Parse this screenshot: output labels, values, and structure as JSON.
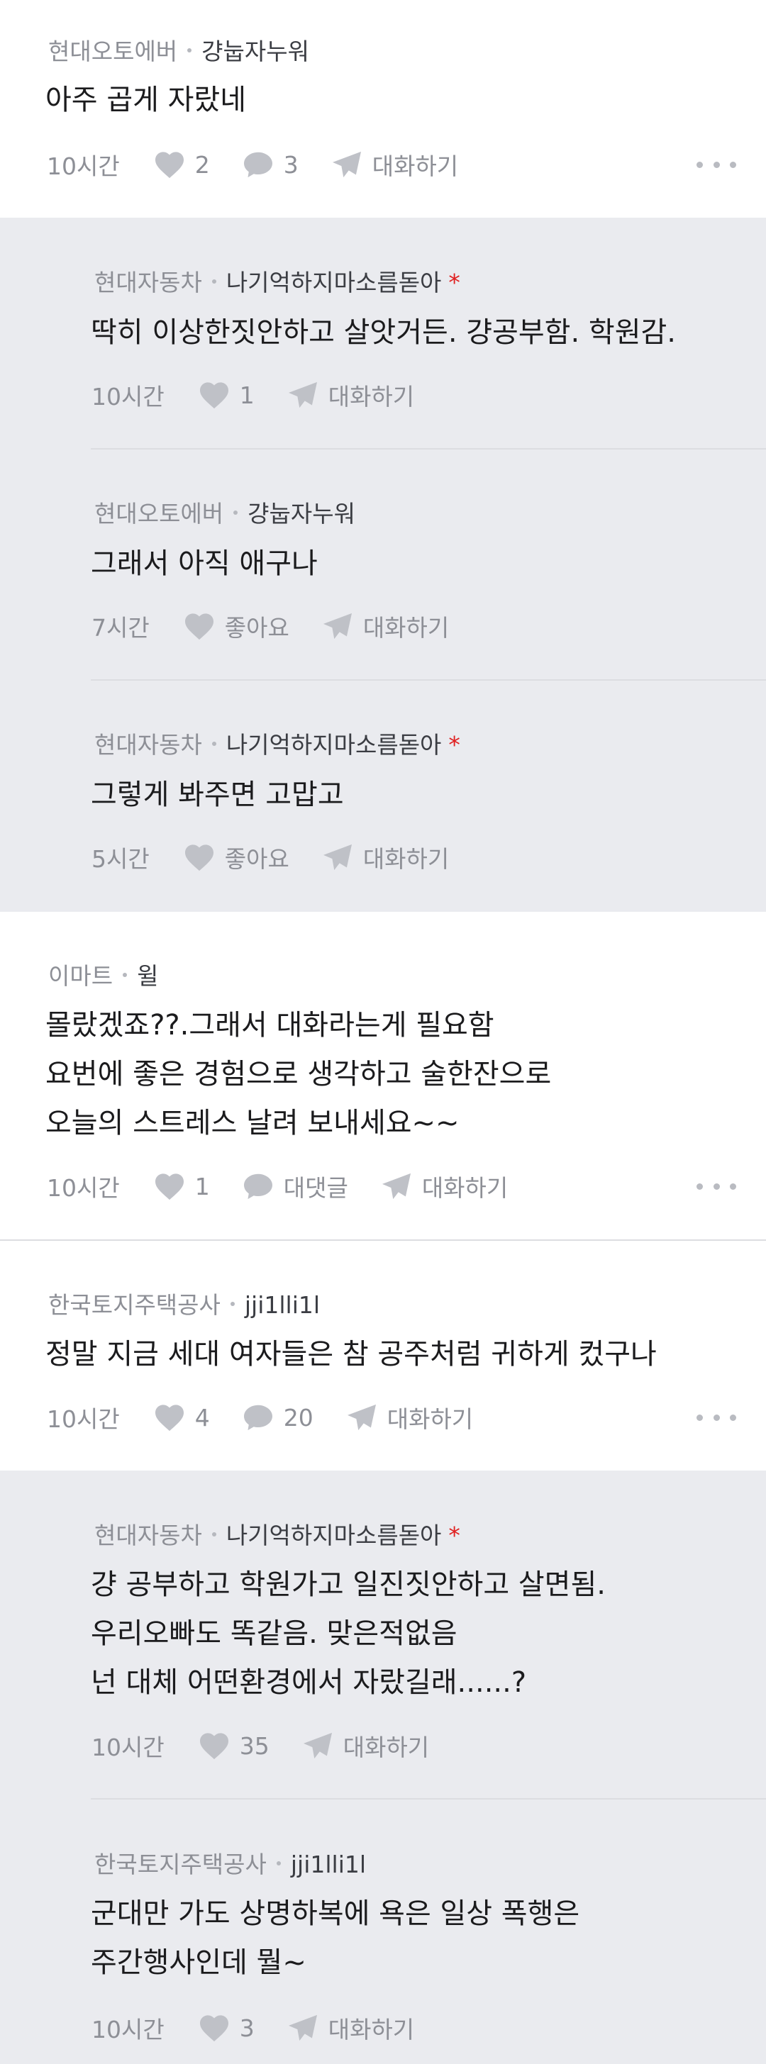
{
  "comments": [
    {
      "company": "현대오토에버",
      "nickname": "걍눕자누워",
      "op": "",
      "text": "아주 곱게 자랐네",
      "time": "10시간",
      "like": "2",
      "reply": "3",
      "talk": "대화하기"
    },
    {
      "company": "현대자동차",
      "nickname": "나기억하지마소름돋아",
      "op": "*",
      "text": "딱히 이상한짓안하고 살앗거든. 걍공부함. 학원감.",
      "time": "10시간",
      "like": "1",
      "talk": "대화하기"
    },
    {
      "company": "현대오토에버",
      "nickname": "걍눕자누워",
      "op": "",
      "text": "그래서 아직 애구나",
      "time": "7시간",
      "like": "좋아요",
      "talk": "대화하기"
    },
    {
      "company": "현대자동차",
      "nickname": "나기억하지마소름돋아",
      "op": "*",
      "text": "그렇게 봐주면 고맙고",
      "time": "5시간",
      "like": "좋아요",
      "talk": "대화하기"
    },
    {
      "company": "이마트",
      "nickname": "윌",
      "op": "",
      "text": "몰랐겠죠??.그래서  대화라는게 필요함\n요번에 좋은 경험으로 생각하고 술한잔으로\n오늘의 스트레스  날려 보내세요~~",
      "time": "10시간",
      "like": "1",
      "reply": "대댓글",
      "talk": "대화하기"
    },
    {
      "company": "한국토지주택공사",
      "nickname": "jji1lli1l",
      "op": "",
      "text": "정말 지금 세대 여자들은 참 공주처럼 귀하게 컸구나",
      "time": "10시간",
      "like": "4",
      "reply": "20",
      "talk": "대화하기"
    },
    {
      "company": "현대자동차",
      "nickname": "나기억하지마소름돋아",
      "op": "*",
      "text": "걍 공부하고 학원가고 일진짓안하고 살면됨.\n우리오빠도 똑같음. 맞은적없음\n넌 대체 어떤환경에서 자랐길래......?",
      "time": "10시간",
      "like": "35",
      "talk": "대화하기"
    },
    {
      "company": "한국토지주택공사",
      "nickname": "jji1lli1l",
      "op": "",
      "text": "군대만 가도 상명하복에 욕은 일상 폭행은\n주간행사인데 뭘~",
      "time": "10시간",
      "like": "3",
      "talk": "대화하기"
    }
  ]
}
